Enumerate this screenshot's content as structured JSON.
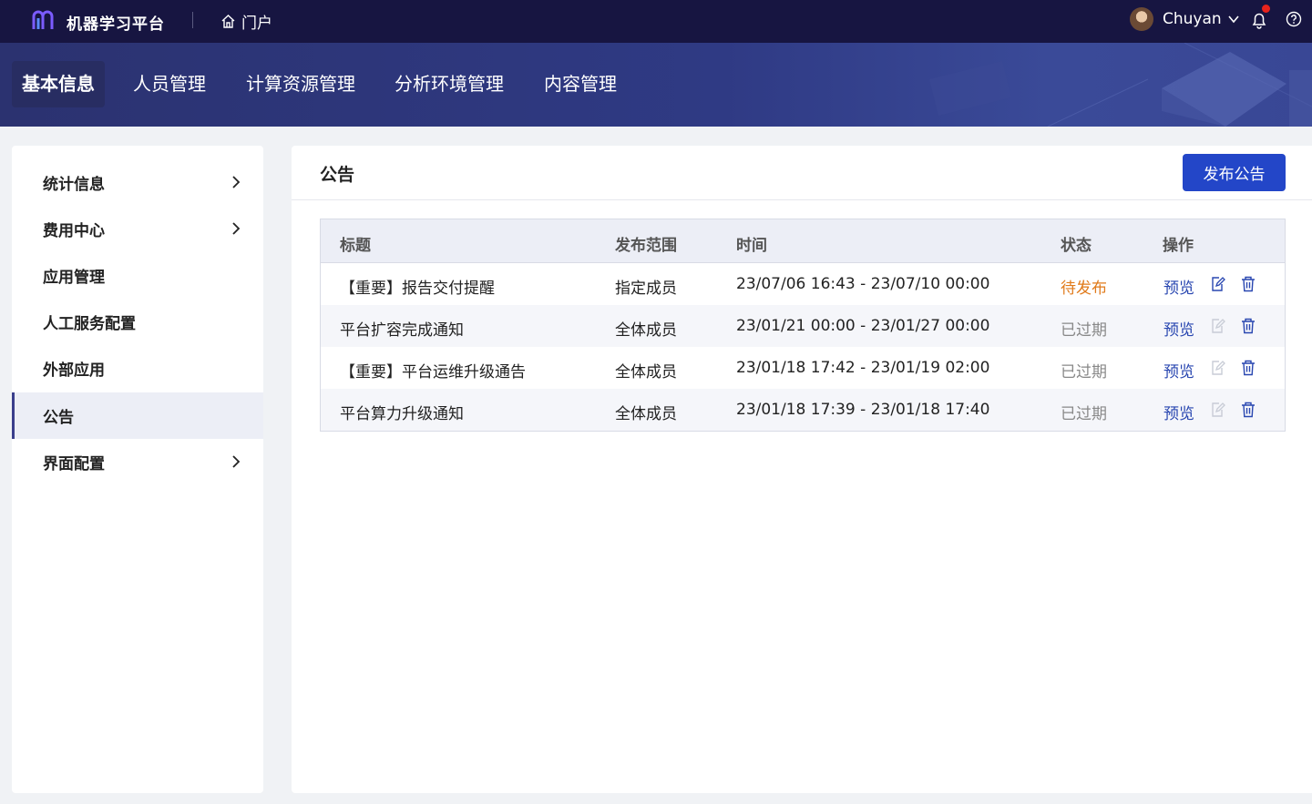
{
  "topbar": {
    "app_title": "机器学习平台",
    "portal_label": "门户",
    "username": "Chuyan"
  },
  "nav": {
    "items": [
      "基本信息",
      "人员管理",
      "计算资源管理",
      "分析环境管理",
      "内容管理"
    ],
    "active": "基本信息"
  },
  "sidebar": {
    "items": [
      {
        "label": "统计信息",
        "has_children": true
      },
      {
        "label": "费用中心",
        "has_children": true
      },
      {
        "label": "应用管理",
        "has_children": false
      },
      {
        "label": "人工服务配置",
        "has_children": false
      },
      {
        "label": "外部应用",
        "has_children": false
      },
      {
        "label": "公告",
        "has_children": false,
        "active": true
      },
      {
        "label": "界面配置",
        "has_children": true
      }
    ]
  },
  "main": {
    "title": "公告",
    "publish_button": "发布公告",
    "table": {
      "columns": [
        "标题",
        "发布范围",
        "时间",
        "状态",
        "操作"
      ],
      "rows": [
        {
          "title": "【重要】报告交付提醒",
          "scope": "指定成员",
          "time": "23/07/06 16:43 - 23/07/10 00:00",
          "status": "待发布",
          "preview": "预览"
        },
        {
          "title": "平台扩容完成通知",
          "scope": "全体成员",
          "time": "23/01/21 00:00 - 23/01/27 00:00",
          "status": "已过期",
          "preview": "预览"
        },
        {
          "title": "【重要】平台运维升级通告",
          "scope": "全体成员",
          "time": "23/01/18 17:42 - 23/01/19 02:00",
          "status": "已过期",
          "preview": "预览"
        },
        {
          "title": "平台算力升级通知",
          "scope": "全体成员",
          "time": "23/01/18 17:39 - 23/01/18 17:40",
          "status": "已过期",
          "preview": "预览"
        }
      ]
    }
  },
  "colors": {
    "topbar": "#171541",
    "accent": "#2346c8",
    "link": "#2846b0",
    "pending": "#e07a1a",
    "expired": "#888888",
    "notification_dot": "#e8231c"
  },
  "icons": [
    "logo-icon",
    "home-icon",
    "chevron-down-icon",
    "bell-icon",
    "help-icon",
    "chevron-right-icon",
    "edit-icon",
    "trash-icon"
  ]
}
